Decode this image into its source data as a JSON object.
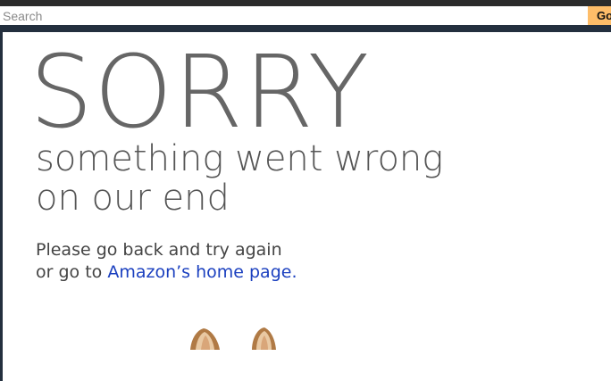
{
  "search": {
    "placeholder": "Search",
    "go_label": "Go"
  },
  "error": {
    "headline": "SORRY",
    "subhead_line1": "something went wrong",
    "subhead_line2": "on our end",
    "message_line1": "Please go back and try again",
    "message_line2_prefix": "or go to ",
    "home_link": "Amazon’s home page",
    "message_line2_suffix": "."
  },
  "illustration": {
    "icon": "dog-ears-illustration"
  },
  "colors": {
    "header": "#232f3e",
    "go_button": "#febd69",
    "link": "#1a3fbf",
    "headline": "#666666"
  }
}
